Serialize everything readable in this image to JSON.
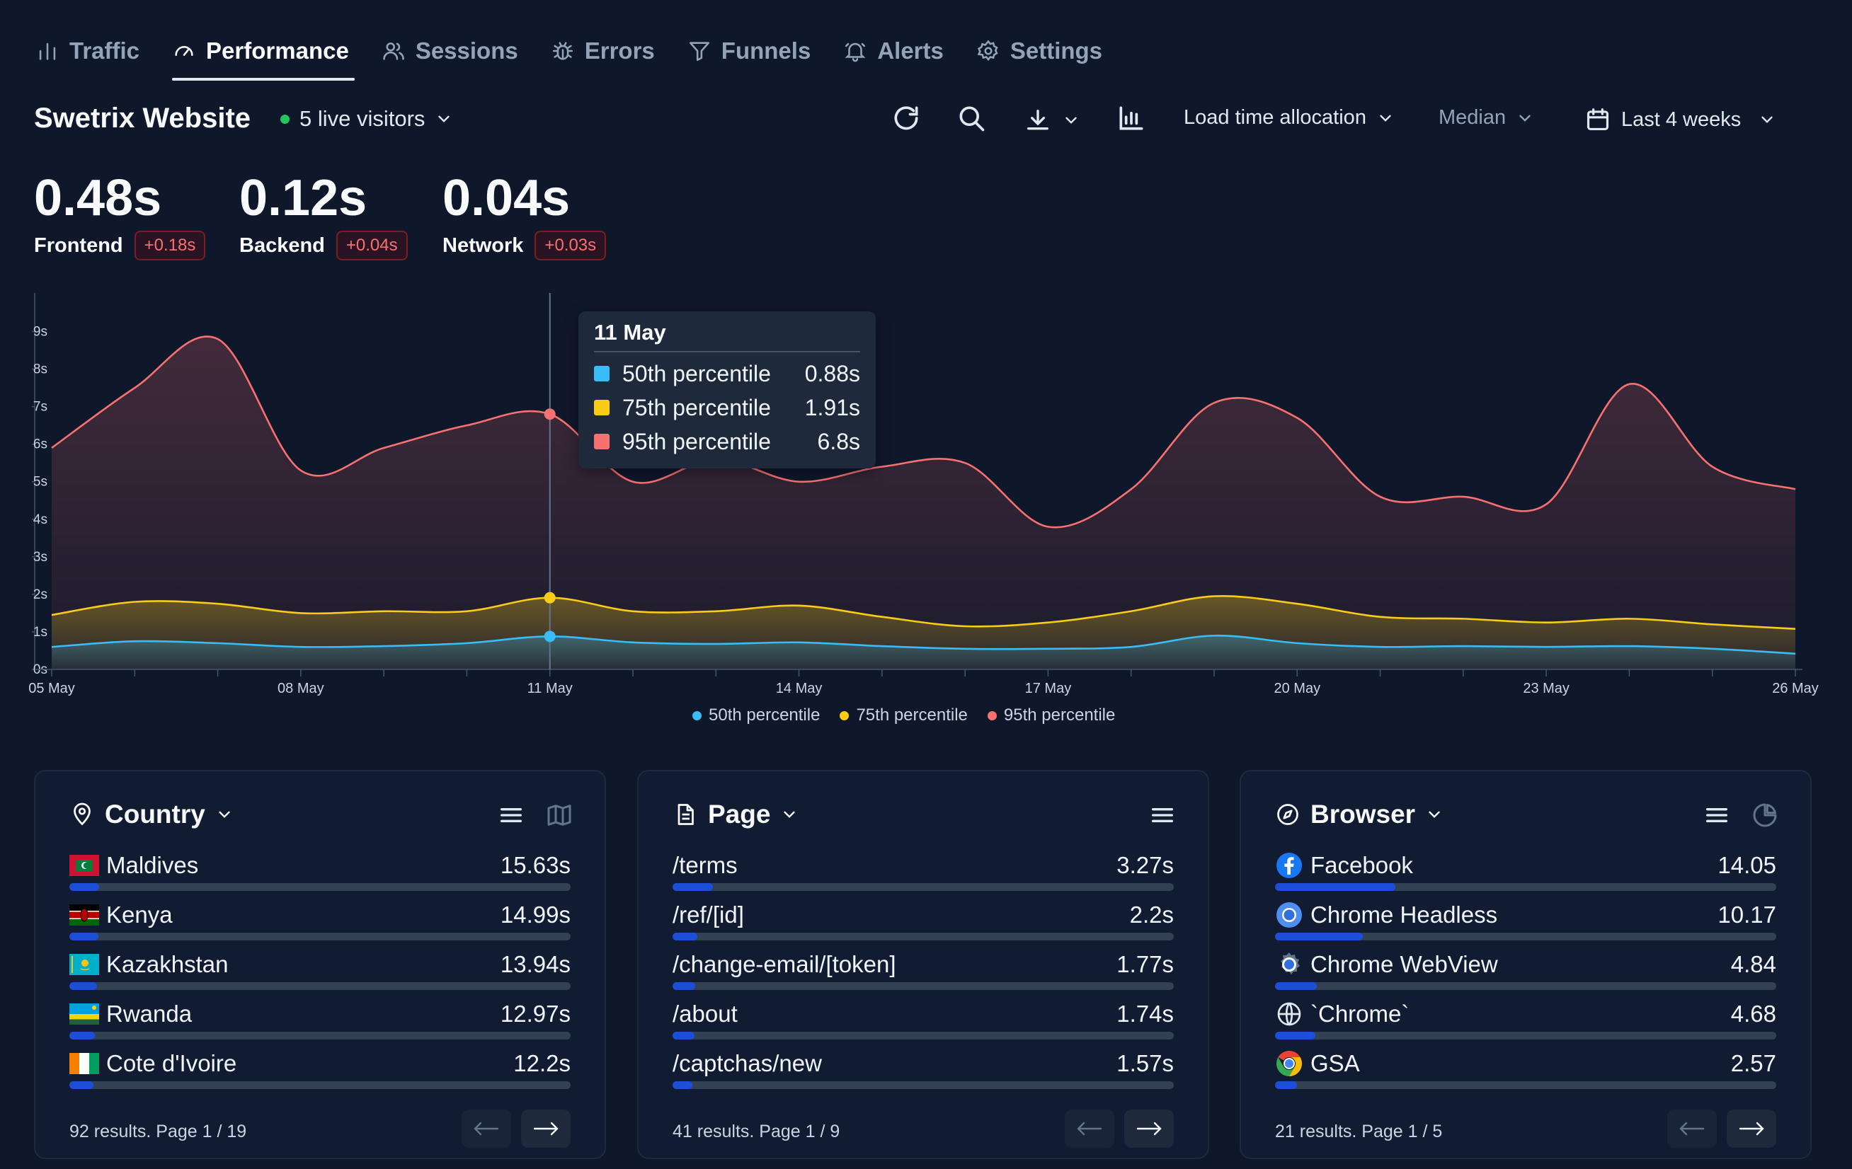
{
  "nav": {
    "tabs": [
      {
        "label": "Traffic",
        "icon": "bar-chart-icon",
        "active": false
      },
      {
        "label": "Performance",
        "icon": "gauge-icon",
        "active": true
      },
      {
        "label": "Sessions",
        "icon": "users-icon",
        "active": false
      },
      {
        "label": "Errors",
        "icon": "bug-icon",
        "active": false
      },
      {
        "label": "Funnels",
        "icon": "funnel-icon",
        "active": false
      },
      {
        "label": "Alerts",
        "icon": "bell-icon",
        "active": false
      },
      {
        "label": "Settings",
        "icon": "gear-icon",
        "active": false
      }
    ]
  },
  "header": {
    "site_title": "Swetrix Website",
    "live_visitors": "5 live visitors",
    "metric_dropdown": "Load time allocation",
    "aggregation_dropdown": "Median",
    "period_dropdown": "Last 4 weeks"
  },
  "metrics": [
    {
      "value": "0.48s",
      "label": "Frontend",
      "delta": "+0.18s"
    },
    {
      "value": "0.12s",
      "label": "Backend",
      "delta": "+0.04s"
    },
    {
      "value": "0.04s",
      "label": "Network",
      "delta": "+0.03s"
    }
  ],
  "tooltip": {
    "title": "11 May",
    "rows": [
      {
        "label": "50th percentile",
        "value": "0.88s",
        "color": "#38bdf8"
      },
      {
        "label": "75th percentile",
        "value": "1.91s",
        "color": "#facc15"
      },
      {
        "label": "95th percentile",
        "value": "6.8s",
        "color": "#f87171"
      }
    ]
  },
  "chart_data": {
    "type": "area",
    "x": [
      "05 May",
      "06 May",
      "07 May",
      "08 May",
      "09 May",
      "10 May",
      "11 May",
      "12 May",
      "13 May",
      "14 May",
      "15 May",
      "16 May",
      "17 May",
      "18 May",
      "19 May",
      "20 May",
      "21 May",
      "22 May",
      "23 May",
      "24 May",
      "25 May",
      "26 May"
    ],
    "x_tick_labels": [
      "05 May",
      "08 May",
      "11 May",
      "14 May",
      "17 May",
      "20 May",
      "23 May",
      "26 May"
    ],
    "y_tick_labels": [
      "0s",
      "1s",
      "2s",
      "3s",
      "4s",
      "5s",
      "6s",
      "7s",
      "8s",
      "9s"
    ],
    "ylim": [
      0,
      9.5
    ],
    "series": [
      {
        "name": "50th percentile",
        "color": "#38bdf8",
        "values": [
          0.6,
          0.75,
          0.7,
          0.6,
          0.62,
          0.7,
          0.88,
          0.72,
          0.68,
          0.72,
          0.62,
          0.55,
          0.55,
          0.6,
          0.9,
          0.7,
          0.6,
          0.62,
          0.6,
          0.62,
          0.55,
          0.42
        ]
      },
      {
        "name": "75th percentile",
        "color": "#facc15",
        "values": [
          1.45,
          1.8,
          1.75,
          1.5,
          1.55,
          1.55,
          1.91,
          1.55,
          1.55,
          1.7,
          1.4,
          1.15,
          1.25,
          1.55,
          1.95,
          1.75,
          1.4,
          1.35,
          1.25,
          1.35,
          1.2,
          1.08
        ]
      },
      {
        "name": "95th percentile",
        "color": "#f87171",
        "values": [
          5.9,
          7.5,
          8.8,
          5.3,
          5.9,
          6.5,
          6.8,
          5.0,
          5.6,
          5.0,
          5.4,
          5.5,
          3.8,
          4.8,
          7.1,
          6.7,
          4.6,
          4.6,
          4.4,
          7.6,
          5.4,
          4.8
        ]
      }
    ],
    "highlight_index": 6,
    "legend": "bottom-center",
    "grid": false
  },
  "panels": [
    {
      "title": "Country",
      "icon": "map-pin-icon",
      "tools": [
        "list-icon",
        "map-icon"
      ],
      "items": [
        {
          "name": "Maldives",
          "value": "15.63s",
          "flag": "mv",
          "share": 0.06
        },
        {
          "name": "Kenya",
          "value": "14.99s",
          "flag": "ke",
          "share": 0.058
        },
        {
          "name": "Kazakhstan",
          "value": "13.94s",
          "flag": "kz",
          "share": 0.055
        },
        {
          "name": "Rwanda",
          "value": "12.97s",
          "flag": "rw",
          "share": 0.051
        },
        {
          "name": "Cote d'Ivoire",
          "value": "12.2s",
          "flag": "ci",
          "share": 0.048
        }
      ],
      "footer": "92 results. Page 1 / 19"
    },
    {
      "title": "Page",
      "icon": "document-icon",
      "tools": [
        "list-icon"
      ],
      "items": [
        {
          "name": "/terms",
          "value": "3.27s",
          "share": 0.08
        },
        {
          "name": "/ref/[id]",
          "value": "2.2s",
          "share": 0.05
        },
        {
          "name": "/change-email/[token]",
          "value": "1.77s",
          "share": 0.045
        },
        {
          "name": "/about",
          "value": "1.74s",
          "share": 0.044
        },
        {
          "name": "/captchas/new",
          "value": "1.57s",
          "share": 0.04
        }
      ],
      "footer": "41 results. Page 1 / 9"
    },
    {
      "title": "Browser",
      "icon": "compass-icon",
      "tools": [
        "list-icon",
        "pie-chart-icon"
      ],
      "items": [
        {
          "name": "Facebook",
          "value": "14.05",
          "icon": "facebook-icon",
          "share": 0.24
        },
        {
          "name": "Chrome Headless",
          "value": "10.17",
          "icon": "chromium-icon",
          "share": 0.175
        },
        {
          "name": "Chrome WebView",
          "value": "4.84",
          "icon": "gear-chrome-icon",
          "share": 0.083
        },
        {
          "name": "`Chrome`",
          "value": "4.68",
          "icon": "globe-icon",
          "share": 0.08
        },
        {
          "name": "GSA",
          "value": "2.57",
          "icon": "chrome-icon",
          "share": 0.044
        }
      ],
      "footer": "21 results. Page 1 / 5"
    }
  ]
}
